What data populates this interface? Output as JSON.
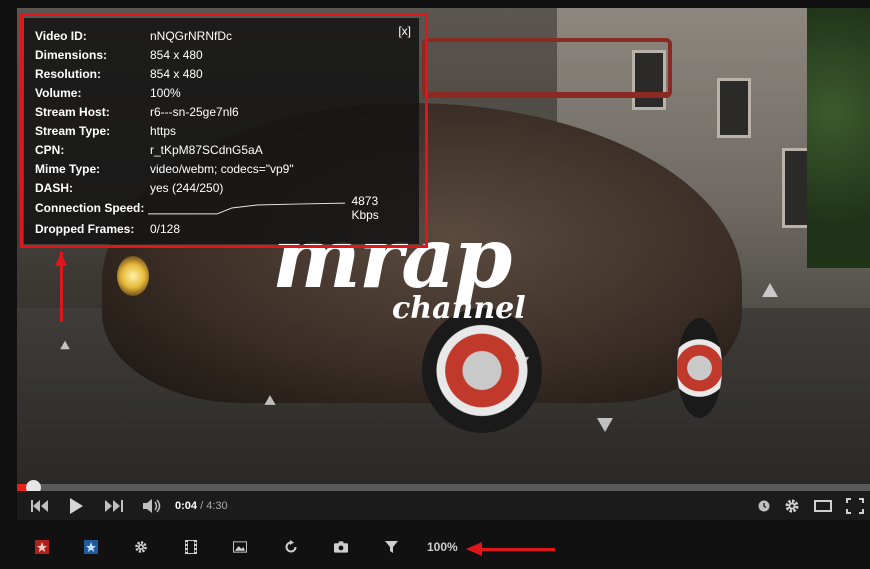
{
  "stats": {
    "close_label": "[x]",
    "rows": [
      {
        "key": "Video ID:",
        "value": "nNQGrNRNfDc"
      },
      {
        "key": "Dimensions:",
        "value": "854 x 480"
      },
      {
        "key": "Resolution:",
        "value": "854 x 480"
      },
      {
        "key": "Volume:",
        "value": "100%"
      },
      {
        "key": "Stream Host:",
        "value": "r6---sn-25ge7nl6"
      },
      {
        "key": "Stream Type:",
        "value": "https"
      },
      {
        "key": "CPN:",
        "value": "r_tKpM87SCdnG5aA"
      },
      {
        "key": "Mime Type:",
        "value": "video/webm; codecs=\"vp9\""
      },
      {
        "key": "DASH:",
        "value": "yes (244/250)"
      }
    ],
    "speed_key": "Connection Speed:",
    "speed_value": "4873 Kbps",
    "dropped_key": "Dropped Frames:",
    "dropped_value": "0/128"
  },
  "video": {
    "logo_main": "mrap",
    "logo_sub": "channel"
  },
  "player": {
    "current_time": "0:04",
    "separator": " / ",
    "duration": "4:30",
    "progress_fraction": 0.0148
  },
  "toolbar": {
    "zoom": "100%",
    "icons": [
      "red-star-icon",
      "blue-star-icon",
      "gear-icon",
      "film-icon",
      "picture-icon",
      "reload-icon",
      "camera-icon",
      "filter-icon"
    ]
  },
  "colors": {
    "accent_red": "#e0161b",
    "progress_red": "#e62117"
  }
}
